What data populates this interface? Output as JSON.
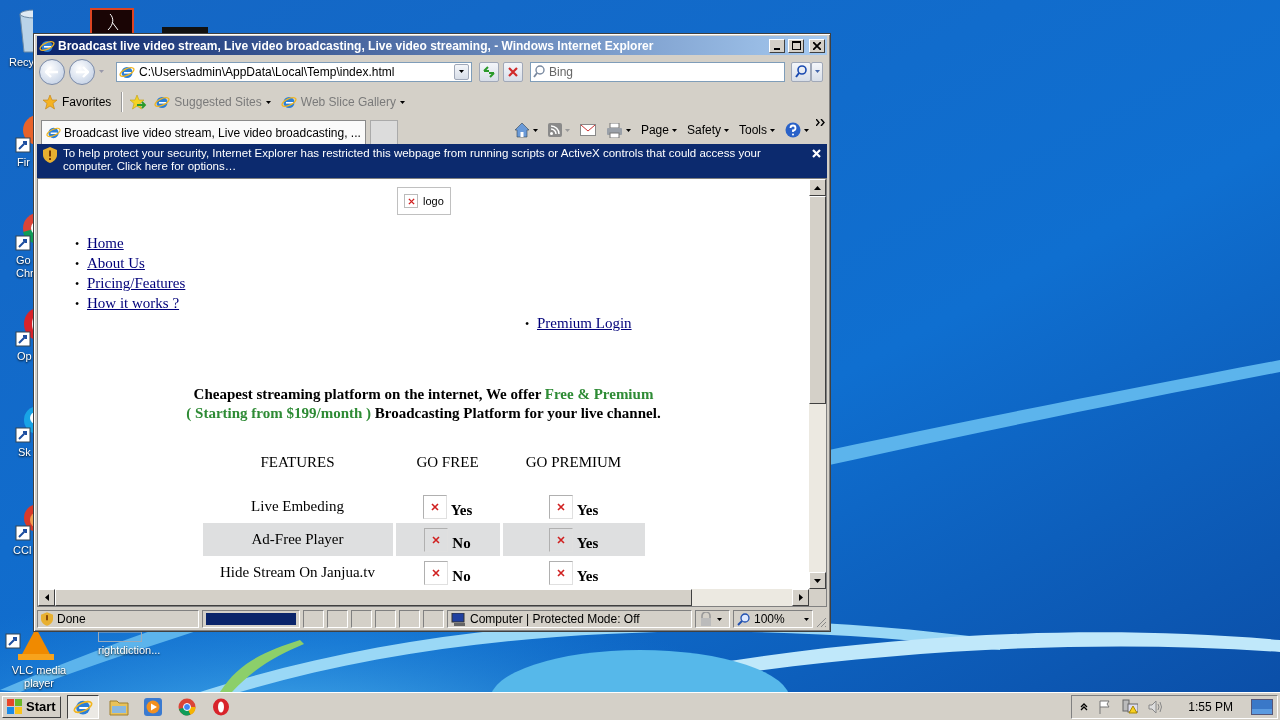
{
  "desktop": {
    "icons": [
      {
        "kind": "recycle",
        "label": "Recy"
      },
      {
        "kind": "pdf"
      },
      {
        "kind": "dark"
      },
      {
        "kind": "firefox",
        "label": "Fir"
      },
      {
        "kind": "chrome",
        "label": "Go Chr"
      },
      {
        "kind": "opera",
        "label": "Op"
      },
      {
        "kind": "skype",
        "label": "Sk"
      },
      {
        "kind": "ccleaner",
        "label": "CCl"
      },
      {
        "kind": "vlc",
        "label": "VLC media player"
      },
      {
        "kind": "file",
        "label": "rightdiction..."
      }
    ]
  },
  "window": {
    "title": "Broadcast live video stream, Live video broadcasting, Live video streaming, - Windows Internet Explorer",
    "address": "C:\\Users\\admin\\AppData\\Local\\Temp\\index.html",
    "search": {
      "placeholder": "Bing"
    },
    "favorites": [
      {
        "kind": "star",
        "label": "Favorites"
      },
      {
        "kind": "add"
      },
      {
        "kind": "site",
        "label": "Suggested Sites"
      },
      {
        "kind": "site",
        "label": "Web Slice Gallery"
      }
    ],
    "tabs": [
      {
        "label": "Broadcast live video stream, Live video broadcasting, ...",
        "selected": true
      }
    ],
    "commands": [
      {
        "kind": "home"
      },
      {
        "kind": "feeds"
      },
      {
        "kind": "mail"
      },
      {
        "kind": "print"
      },
      {
        "kind": "menu",
        "label": "Page"
      },
      {
        "kind": "menu",
        "label": "Safety"
      },
      {
        "kind": "menu",
        "label": "Tools"
      },
      {
        "kind": "help"
      }
    ],
    "info_bar": "To help protect your security, Internet Explorer has restricted this webpage from running scripts or ActiveX controls that could access your computer. Click here for options…",
    "page": {
      "logo_alt": "logo",
      "nav": [
        {
          "bullet": "•",
          "label": "Home"
        },
        {
          "bullet": "•",
          "label": "About Us"
        },
        {
          "bullet": "•",
          "label": "Pricing/Features"
        },
        {
          "bullet": "•",
          "label": "How it works ?"
        }
      ],
      "login_links": [
        {
          "bullet": "•",
          "label": "Premium Login"
        }
      ],
      "headline": [
        [
          {
            "text": "Cheapest streaming platform on the internet, We offer ",
            "highlight": false
          },
          {
            "text": "Free & Premium",
            "highlight": true
          }
        ],
        [
          {
            "text": "( Starting from $199/month )",
            "highlight": true
          },
          {
            "text": " Broadcasting Platform for your live channel.",
            "highlight": false
          }
        ]
      ],
      "table": {
        "columns": [
          "FEATURES",
          "GO FREE",
          "GO PREMIUM"
        ],
        "rows": [
          {
            "feature": "Live Embeding",
            "free": "Yes",
            "premium": "Yes"
          },
          {
            "feature": "Ad-Free Player",
            "free": "No",
            "premium": "Yes"
          },
          {
            "feature": "Hide Stream On Janjua.tv",
            "free": "No",
            "premium": "Yes"
          }
        ]
      }
    },
    "status_bar": {
      "text": "Done",
      "progress": {
        "level": 1
      },
      "zone": "Computer | Protected Mode: Off",
      "zoom": "100%"
    }
  },
  "taskbar": {
    "start": "Start",
    "apps": [
      {
        "kind": "ie",
        "selected": true
      },
      {
        "kind": "explorer",
        "selected": false
      },
      {
        "kind": "media",
        "selected": false
      },
      {
        "kind": "chrome",
        "selected": false
      },
      {
        "kind": "opera",
        "selected": false
      }
    ],
    "clock": "1:55 PM"
  }
}
